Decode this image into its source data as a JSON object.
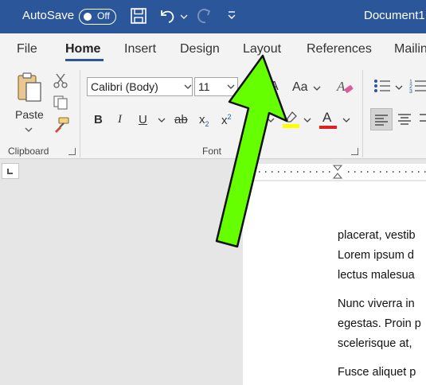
{
  "titlebar": {
    "autosave_label": "AutoSave",
    "autosave_state": "Off",
    "document_title": "Document1"
  },
  "tabs": [
    {
      "label": "File"
    },
    {
      "label": "Home"
    },
    {
      "label": "Insert"
    },
    {
      "label": "Design"
    },
    {
      "label": "Layout"
    },
    {
      "label": "References"
    },
    {
      "label": "Mailin"
    }
  ],
  "active_tab": "Home",
  "ribbon": {
    "clipboard": {
      "label": "Clipboard",
      "paste_label": "Paste"
    },
    "font": {
      "label": "Font",
      "font_name": "Calibri (Body)",
      "font_size": "11",
      "bold": "B",
      "italic": "I",
      "underline": "U",
      "strikethrough": "ab",
      "subscript": "x",
      "subscript_mark": "2",
      "superscript": "x",
      "superscript_mark": "2",
      "change_case": "Aa",
      "grow_font": "A",
      "font_color_letter": "A",
      "highlight_color": "#ffff00",
      "font_color": "#e01f1f"
    }
  },
  "document": {
    "lines": [
      "placerat, vestib",
      "Lorem ipsum d",
      "lectus malesua",
      "Nunc viverra in",
      "egestas. Proin p",
      "scelerisque at, ",
      "Fusce aliquet p"
    ]
  },
  "annotation": {
    "arrow_color": "#66ff00"
  },
  "colors": {
    "title_bar": "#2b579a",
    "ribbon_bg": "#f3f3f3",
    "canvas_bg": "#e6e6e6"
  }
}
